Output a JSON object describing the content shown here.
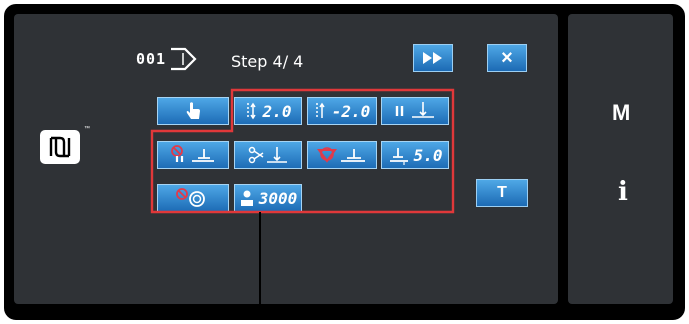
{
  "header": {
    "program_number": "001",
    "step_text": "Step  4/ 4",
    "next_label": "▶▶",
    "close_label": "×"
  },
  "buttons": {
    "thread_tension_1_value": "2.0",
    "thread_tension_2_value": "-2.0",
    "presser_value": "5.0",
    "counter_value": "3000",
    "t_label": "T"
  },
  "side": {
    "menu_label": "M",
    "info_label": "i"
  },
  "nfc": {
    "tm": "™"
  },
  "colors": {
    "button_top": "#4ea7e6",
    "button_bottom": "#1d6cb6",
    "highlight_red": "#e0383a",
    "panel": "#2f3236",
    "icon_red": "#e23a4a"
  }
}
